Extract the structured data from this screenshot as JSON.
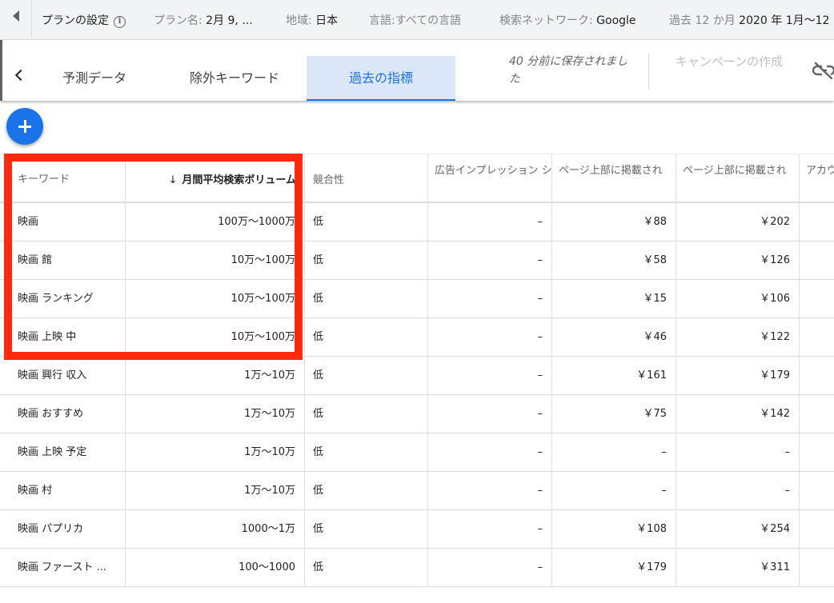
{
  "topbar": {
    "title": "プランの設定",
    "plan_name_label": "プラン名:",
    "plan_name_value": "2月 9, ...",
    "region_label": "地域:",
    "region_value": "日本",
    "language_label": "言語:",
    "language_value": "すべての言語",
    "network_label": "検索ネットワーク:",
    "network_value": "Google",
    "period_label": "過去 12 か月",
    "period_value": "2020 年 1月〜12"
  },
  "tabs": [
    {
      "label": "予測データ"
    },
    {
      "label": "除外キーワード"
    },
    {
      "label": "過去の指標"
    }
  ],
  "saved_text": "40 分前に保存されました",
  "create_campaign": "キャンペーンの作成",
  "icons": {
    "back": "back-triangle-icon",
    "prev": "chevron-left-icon",
    "info": "info-icon",
    "unlink": "link-off-icon",
    "add": "plus-icon",
    "sort": "arrow-down-icon"
  },
  "colors": {
    "accent": "#1a73e8",
    "highlight": "#ff2a0d",
    "active_tab_bg": "#dbe6f8"
  },
  "table": {
    "columns": [
      "キーワード",
      "月間平均検索ボリューム",
      "競合性",
      "広告インプレッション シェア",
      "ページ上部に掲載され",
      "ページ上部に掲載され",
      "アカウ"
    ],
    "rows": [
      {
        "keyword": "映画",
        "volume": "100万〜1000万",
        "competition": "低",
        "impression_share": "–",
        "bid_low": "￥88",
        "bid_high": "￥202"
      },
      {
        "keyword": "映画 館",
        "volume": "10万〜100万",
        "competition": "低",
        "impression_share": "–",
        "bid_low": "￥58",
        "bid_high": "￥126"
      },
      {
        "keyword": "映画 ランキング",
        "volume": "10万〜100万",
        "competition": "低",
        "impression_share": "–",
        "bid_low": "￥15",
        "bid_high": "￥106"
      },
      {
        "keyword": "映画 上映 中",
        "volume": "10万〜100万",
        "competition": "低",
        "impression_share": "–",
        "bid_low": "￥46",
        "bid_high": "￥122"
      },
      {
        "keyword": "映画 興行 収入",
        "volume": "1万〜10万",
        "competition": "低",
        "impression_share": "–",
        "bid_low": "￥161",
        "bid_high": "￥179"
      },
      {
        "keyword": "映画 おすすめ",
        "volume": "1万〜10万",
        "competition": "低",
        "impression_share": "–",
        "bid_low": "￥75",
        "bid_high": "￥142"
      },
      {
        "keyword": "映画 上映 予定",
        "volume": "1万〜10万",
        "competition": "低",
        "impression_share": "–",
        "bid_low": "–",
        "bid_high": "–"
      },
      {
        "keyword": "映画 村",
        "volume": "1万〜10万",
        "competition": "低",
        "impression_share": "–",
        "bid_low": "–",
        "bid_high": "–"
      },
      {
        "keyword": "映画 パプリカ",
        "volume": "1000〜1万",
        "competition": "低",
        "impression_share": "–",
        "bid_low": "￥108",
        "bid_high": "￥254"
      },
      {
        "keyword": "映画 ファースト ...",
        "volume": "100〜1000",
        "competition": "低",
        "impression_share": "–",
        "bid_low": "￥179",
        "bid_high": "￥311"
      }
    ]
  }
}
